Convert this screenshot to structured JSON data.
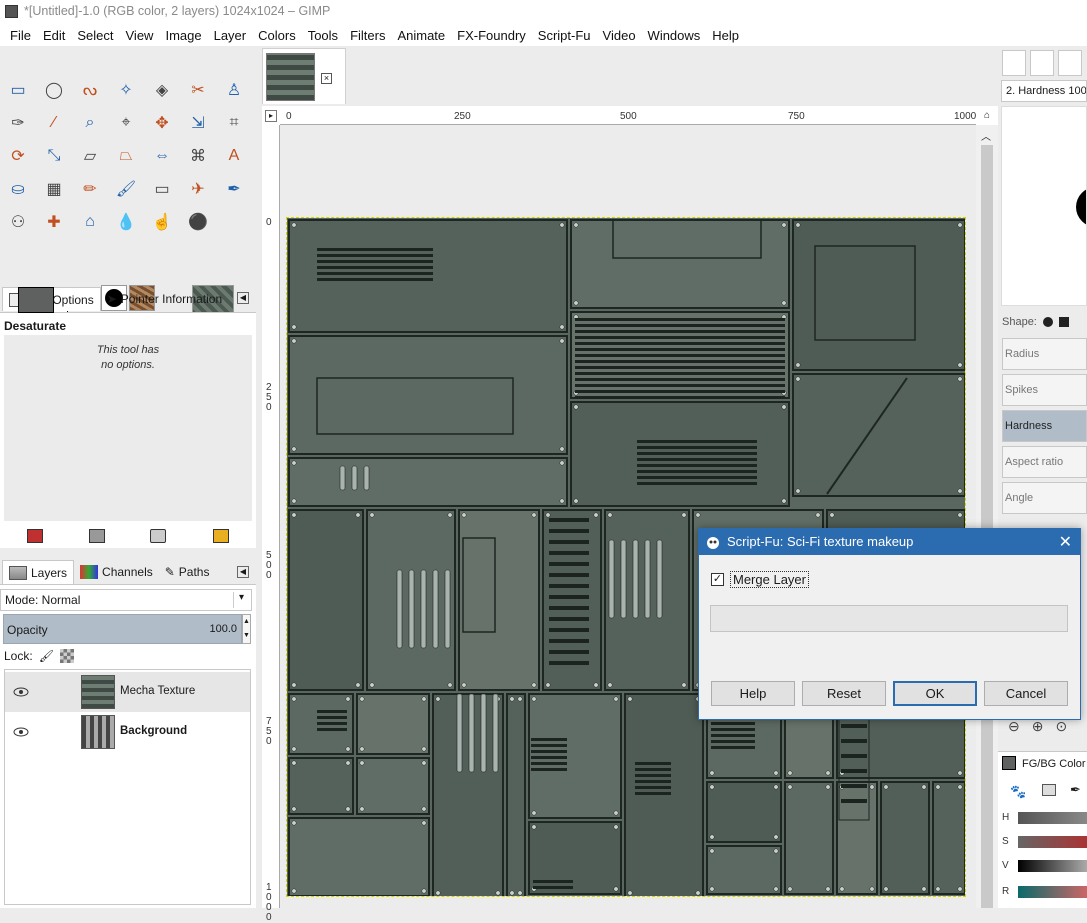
{
  "window": {
    "title": "*[Untitled]-1.0 (RGB color, 2 layers) 1024x1024 – GIMP"
  },
  "menu": [
    "File",
    "Edit",
    "Select",
    "View",
    "Image",
    "Layer",
    "Colors",
    "Tools",
    "Filters",
    "Animate",
    "FX-Foundry",
    "Script-Fu",
    "Video",
    "Windows",
    "Help"
  ],
  "toolbox": {
    "icons": [
      "rect-select-icon",
      "ellipse-select-icon",
      "free-select-icon",
      "fuzzy-select-icon",
      "by-color-select-icon",
      "scissors-icon",
      "foreground-select-icon",
      "paths-icon",
      "color-picker-icon",
      "zoom-icon",
      "measure-icon",
      "move-icon",
      "align-icon",
      "crop-icon",
      "rotate-icon",
      "scale-icon",
      "shear-icon",
      "perspective-icon",
      "flip-icon",
      "cage-icon",
      "text-icon",
      "bucket-fill-icon",
      "blend-icon",
      "pencil-icon",
      "paintbrush-icon",
      "eraser-icon",
      "airbrush-icon",
      "ink-icon",
      "clone-icon",
      "heal-icon",
      "perspective-clone-icon",
      "blur-icon",
      "smudge-icon",
      "dodge-burn-icon"
    ]
  },
  "tool_options": {
    "tab1": "Tool Options",
    "tab2": "Pointer Information",
    "title": "Desaturate",
    "message_line1": "This tool has",
    "message_line2": "no options."
  },
  "layers_panel": {
    "tabs": [
      "Layers",
      "Channels",
      "Paths"
    ],
    "mode": "Mode: Normal",
    "opacity_label": "Opacity",
    "opacity_value": "100.0",
    "lock_label": "Lock:",
    "layers": [
      {
        "name": "Mecha Texture",
        "selected": true,
        "bold": false
      },
      {
        "name": "Background",
        "selected": false,
        "bold": true
      }
    ]
  },
  "canvas": {
    "ruler_h": [
      "0",
      "250",
      "500",
      "750",
      "1000"
    ],
    "ruler_v": [
      "0",
      "250",
      "500",
      "750",
      "1000"
    ]
  },
  "right_dock": {
    "brush_name": "2. Hardness 100",
    "shape_label": "Shape:",
    "props": [
      "Radius",
      "Spikes",
      "Hardness",
      "Aspect ratio",
      "Angle"
    ],
    "active_prop": "Hardness",
    "fgbg_title": "FG/BG Color",
    "sliders": [
      "H",
      "S",
      "V",
      "R"
    ]
  },
  "dialog": {
    "title": "Script-Fu: Sci-Fi texture makeup",
    "merge_label": "Merge Layer",
    "merge_checked": true,
    "buttons": {
      "help": "Help",
      "reset": "Reset",
      "ok": "OK",
      "cancel": "Cancel"
    }
  }
}
